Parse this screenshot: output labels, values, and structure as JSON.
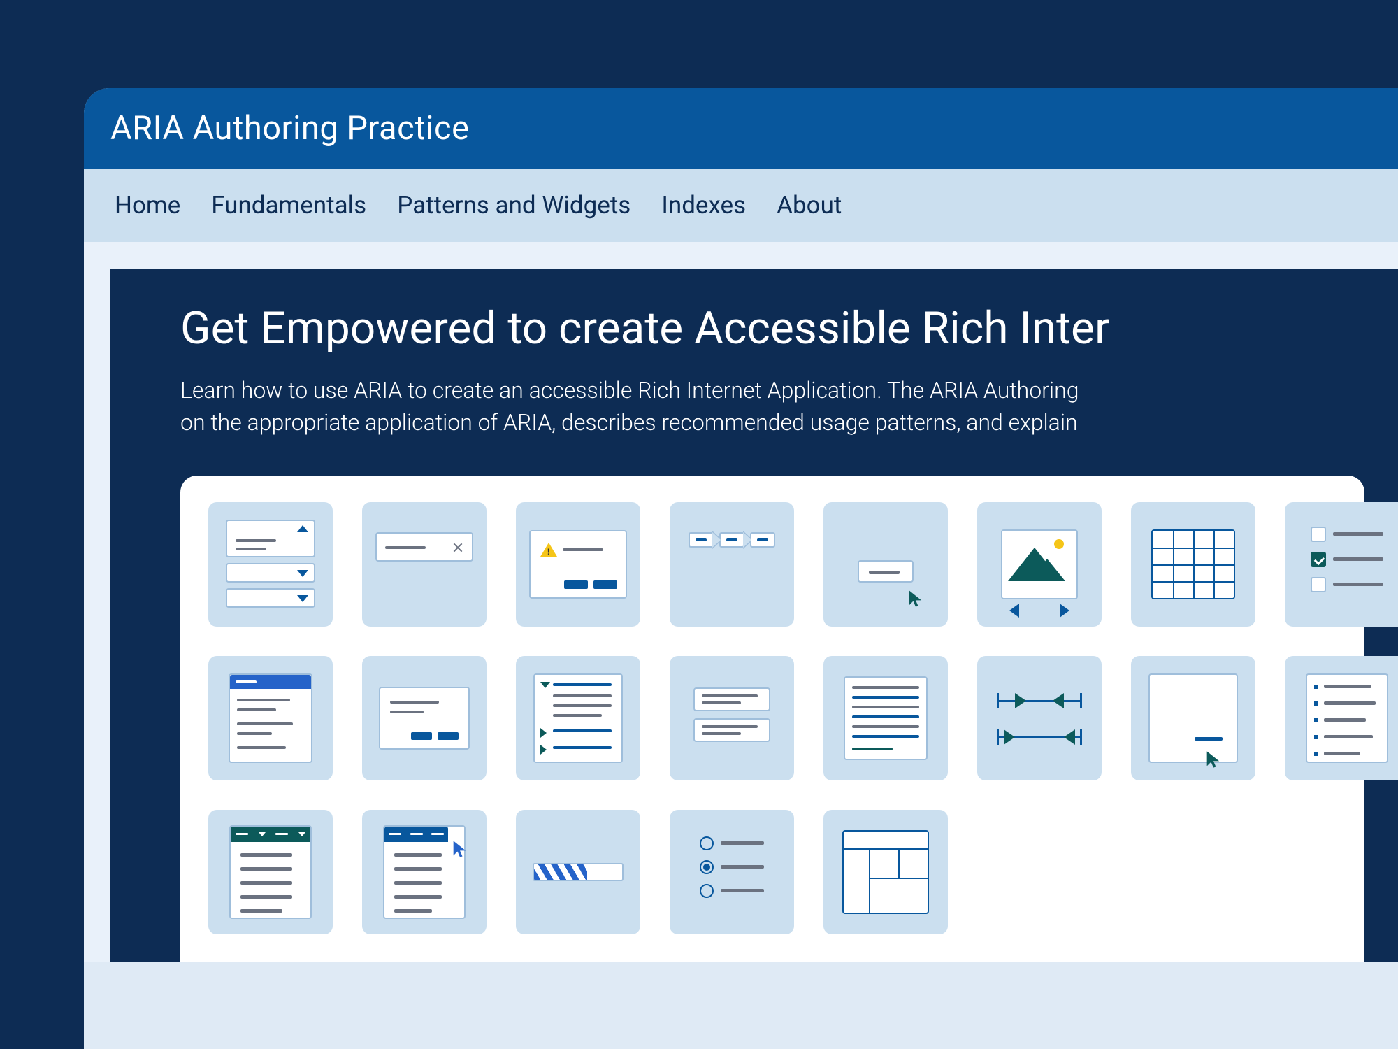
{
  "header": {
    "title": "ARIA  Authoring Practice"
  },
  "nav": {
    "items": [
      "Home",
      "Fundamentals",
      "Patterns and Widgets",
      "Indexes",
      "About"
    ]
  },
  "hero": {
    "title": "Get Empowered to create Accessible Rich Inter",
    "line1": "Learn how to use ARIA to create an accessible Rich Internet Application. The ARIA Authoring ",
    "line2": "on the appropriate application of ARIA, describes  recommended usage patterns, and explain"
  },
  "patterns": {
    "row1": [
      "accordion",
      "alert",
      "alertdialog",
      "breadcrumb",
      "button",
      "carousel",
      "table"
    ],
    "row2": [
      "checkbox",
      "combobox",
      "dialog",
      "disclosure",
      "feed",
      "grid",
      "slider"
    ],
    "row3": [
      "link",
      "listbox",
      "menu",
      "menubar",
      "meter",
      "radiogroup",
      "layout-table"
    ]
  }
}
